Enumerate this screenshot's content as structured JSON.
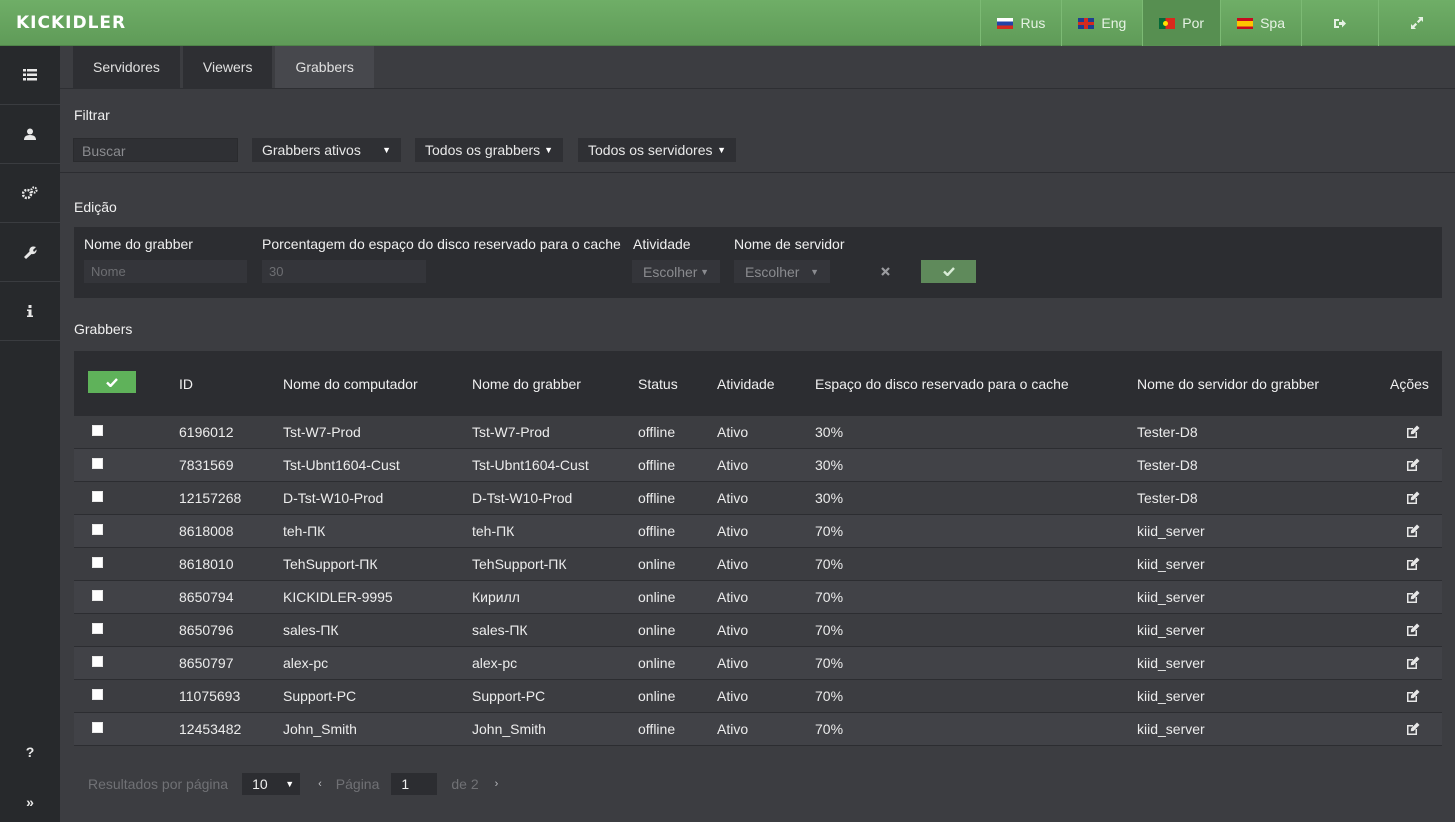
{
  "app": {
    "logo": "KICKIDLER"
  },
  "topnav": {
    "languages": [
      {
        "label": "Rus",
        "flag": "ru-flag-icon"
      },
      {
        "label": "Eng",
        "flag": "uk-flag-icon"
      },
      {
        "label": "Por",
        "flag": "pt-flag-icon",
        "active": true
      },
      {
        "label": "Spa",
        "flag": "es-flag-icon"
      }
    ],
    "icons": [
      "logout-icon",
      "fullscreen-icon"
    ]
  },
  "sidebar": {
    "icons": [
      "list-icon",
      "user-icon",
      "settings-icon",
      "wrench-icon",
      "info-icon"
    ],
    "help": "?",
    "expand": "»"
  },
  "tabs": [
    {
      "label": "Servidores"
    },
    {
      "label": "Viewers"
    },
    {
      "label": "Grabbers",
      "active": true
    }
  ],
  "filter": {
    "title": "Filtrar",
    "search_placeholder": "Buscar",
    "status_select": "Grabbers ativos",
    "grabbers_select": "Todos os grabbers",
    "servers_select": "Todos os servidores"
  },
  "edit": {
    "title": "Edição",
    "name_label": "Nome do grabber",
    "name_placeholder": "Nome",
    "cache_label": "Porcentagem do espaço do disco reservado para o cache",
    "cache_placeholder": "30",
    "activity_label": "Atividade",
    "activity_select": "Escolher",
    "server_label": "Nome de servidor",
    "server_select": "Escolher"
  },
  "grabbers": {
    "title": "Grabbers",
    "columns": [
      "ID",
      "Nome do computador",
      "Nome do grabber",
      "Status",
      "Atividade",
      "Espaço do disco reservado para o cache",
      "Nome do servidor do grabber",
      "Ações"
    ],
    "rows": [
      {
        "id": "6196012",
        "computer": "Tst-W7-Prod",
        "grabber": "Tst-W7-Prod",
        "status": "offline",
        "activity": "Ativo",
        "cache": "30%",
        "server": "Tester-D8"
      },
      {
        "id": "7831569",
        "computer": "Tst-Ubnt1604-Cust",
        "grabber": "Tst-Ubnt1604-Cust",
        "status": "offline",
        "activity": "Ativo",
        "cache": "30%",
        "server": "Tester-D8"
      },
      {
        "id": "12157268",
        "computer": "D-Tst-W10-Prod",
        "grabber": "D-Tst-W10-Prod",
        "status": "offline",
        "activity": "Ativo",
        "cache": "30%",
        "server": "Tester-D8"
      },
      {
        "id": "8618008",
        "computer": "teh-ПК",
        "grabber": "teh-ПК",
        "status": "offline",
        "activity": "Ativo",
        "cache": "70%",
        "server": "kiid_server"
      },
      {
        "id": "8618010",
        "computer": "TehSupport-ПК",
        "grabber": "TehSupport-ПК",
        "status": "online",
        "activity": "Ativo",
        "cache": "70%",
        "server": "kiid_server"
      },
      {
        "id": "8650794",
        "computer": "KICKIDLER-9995",
        "grabber": "Кирилл",
        "status": "online",
        "activity": "Ativo",
        "cache": "70%",
        "server": "kiid_server"
      },
      {
        "id": "8650796",
        "computer": "sales-ПК",
        "grabber": "sales-ПК",
        "status": "online",
        "activity": "Ativo",
        "cache": "70%",
        "server": "kiid_server"
      },
      {
        "id": "8650797",
        "computer": "alex-pc",
        "grabber": "alex-pc",
        "status": "online",
        "activity": "Ativo",
        "cache": "70%",
        "server": "kiid_server"
      },
      {
        "id": "11075693",
        "computer": "Support-PC",
        "grabber": "Support-PC",
        "status": "online",
        "activity": "Ativo",
        "cache": "70%",
        "server": "kiid_server"
      },
      {
        "id": "12453482",
        "computer": "John_Smith",
        "grabber": "John_Smith",
        "status": "offline",
        "activity": "Ativo",
        "cache": "70%",
        "server": "kiid_server"
      }
    ]
  },
  "pagination": {
    "per_page_label": "Resultados por página",
    "per_page_value": "10",
    "prev": "‹",
    "page_label": "Página",
    "page_value": "1",
    "of_label": "de 2",
    "next": "›"
  }
}
